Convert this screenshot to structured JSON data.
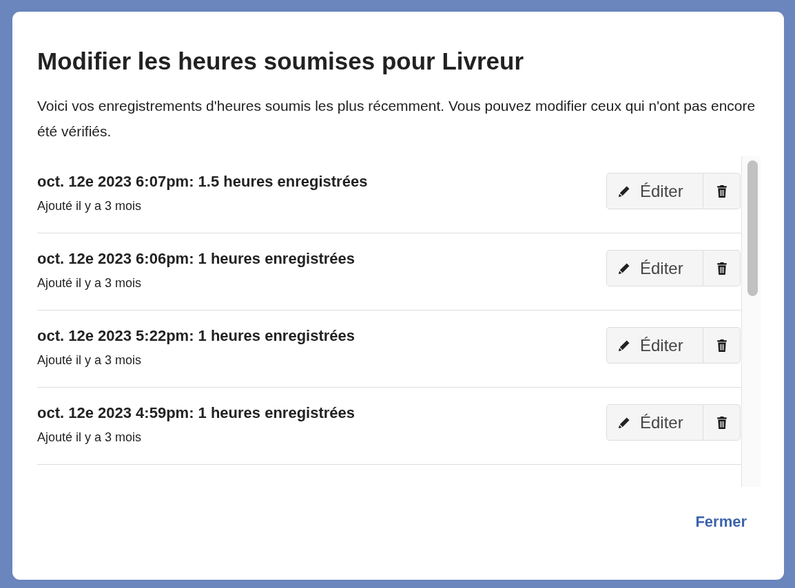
{
  "dialog": {
    "title": "Modifier les heures soumises pour Livreur",
    "description": "Voici vos enregistrements d'heures soumis les plus récemment. Vous pouvez modifier ceux qui n'ont pas encore été vérifiés.",
    "entries": [
      {
        "title": "oct. 12e 2023 6:07pm: 1.5 heures enregistrées",
        "added": "Ajouté il y a 3 mois",
        "edit_label": "Éditer"
      },
      {
        "title": "oct. 12e 2023 6:06pm: 1 heures enregistrées",
        "added": "Ajouté il y a 3 mois",
        "edit_label": "Éditer"
      },
      {
        "title": "oct. 12e 2023 5:22pm: 1 heures enregistrées",
        "added": "Ajouté il y a 3 mois",
        "edit_label": "Éditer"
      },
      {
        "title": "oct. 12e 2023 4:59pm: 1 heures enregistrées",
        "added": "Ajouté il y a 3 mois",
        "edit_label": "Éditer"
      }
    ],
    "close_label": "Fermer"
  }
}
